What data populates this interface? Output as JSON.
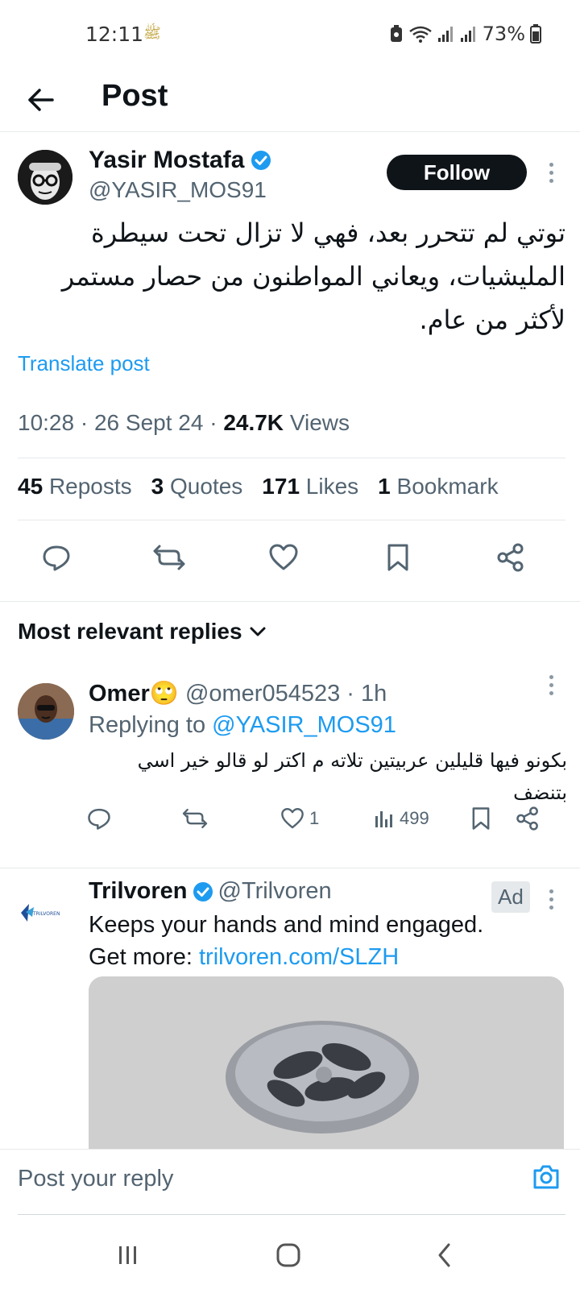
{
  "status_bar": {
    "time": "12:11",
    "battery": "73%"
  },
  "header": {
    "title": "Post"
  },
  "post": {
    "author_name": "Yasir Mostafa",
    "author_handle": "@YASIR_MOS91",
    "follow_label": "Follow",
    "text": "توتي لم تتحرر بعد، فهي لا تزال تحت سيطرة المليشيات، ويعاني المواطنون من حصار مستمر لأكثر من عام.",
    "translate_label": "Translate post",
    "time": "10:28",
    "date": "26 Sept 24",
    "views_count": "24.7K",
    "views_label": "Views",
    "stats": {
      "reposts_count": "45",
      "reposts_label": "Reposts",
      "quotes_count": "3",
      "quotes_label": "Quotes",
      "likes_count": "171",
      "likes_label": "Likes",
      "bookmarks_count": "1",
      "bookmarks_label": "Bookmark"
    }
  },
  "replies_sort": {
    "label": "Most relevant replies"
  },
  "reply": {
    "name": "Omer🙄",
    "handle": "@omer054523",
    "age": "1h",
    "replying_prefix": "Replying to",
    "replying_handle": "@YASIR_MOS91",
    "text": "بكونو فيها قليلين عربيتين تلاته م اكتر لو قالو خير اسي بتنضف",
    "likes": "1",
    "views": "499"
  },
  "ad": {
    "name": "Trilvoren",
    "handle": "@Trilvoren",
    "badge": "Ad",
    "line1": "Keeps your hands and mind engaged.",
    "line2_prefix": "Get more:",
    "link": "trilvoren.com/SLZH",
    "logo_text": "TRILVOREN"
  },
  "reply_bar": {
    "placeholder": "Post your reply"
  },
  "colors": {
    "accent": "#1d9bf0",
    "text": "#0f1419",
    "muted": "#536471",
    "border": "#e6e9eb"
  }
}
